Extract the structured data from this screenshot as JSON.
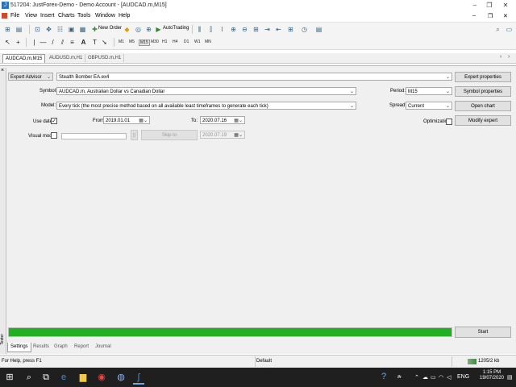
{
  "window": {
    "title": "517204: JustForex-Demo - Demo Account - [AUDCAD.m,M15]"
  },
  "menu": [
    "File",
    "View",
    "Insert",
    "Charts",
    "Tools",
    "Window",
    "Help"
  ],
  "toolbar": {
    "new_order": "New Order",
    "autotrading": "AutoTrading"
  },
  "timeframes": [
    "M1",
    "M5",
    "M15",
    "M30",
    "H1",
    "H4",
    "D1",
    "W1",
    "MN"
  ],
  "chart_tabs": [
    "AUDCAD.m,M15",
    "AUDUSD.m,H1",
    "GBPUSD.m,H1"
  ],
  "tester": {
    "type_select": "Expert Advisor",
    "expert_value": "Stealth Bomber EA.ex4",
    "symbol_label": "Symbol:",
    "symbol_value": "AUDCAD.m, Australian Dollar vs Canadian Dollar",
    "model_label": "Model:",
    "model_value": "Every tick (the most precise method based on all available least timeframes to generate each tick)",
    "use_date_label": "Use date",
    "use_date_checked": "✓",
    "from_label": "From:",
    "from_value": "2019.01.01",
    "to_label": "To:",
    "to_value": "2020.07.16",
    "visual_mode_label": "Visual mode",
    "pause_label": "||",
    "skip_to_label": "Skip to",
    "skip_to_value": "2020.07.19",
    "period_label": "Period:",
    "period_value": "M15",
    "spread_label": "Spread:",
    "spread_value": "Current",
    "optimization_label": "Optimization",
    "buttons": {
      "expert_properties": "Expert properties",
      "symbol_properties": "Symbol properties",
      "open_chart": "Open chart",
      "modify_expert": "Modify expert",
      "start": "Start"
    },
    "progress_fraction": 1.0,
    "progress_color": "#22b022"
  },
  "bottom_tabs": [
    "Settings",
    "Results",
    "Graph",
    "Report",
    "Journal"
  ],
  "side_label": "Tester",
  "status": {
    "help": "For Help, press F1",
    "profile": "Default",
    "traffic": "1205/2 kb"
  },
  "taskbar": {
    "lang": "ENG",
    "time": "1:15 PM",
    "date": "19/07/2020"
  }
}
